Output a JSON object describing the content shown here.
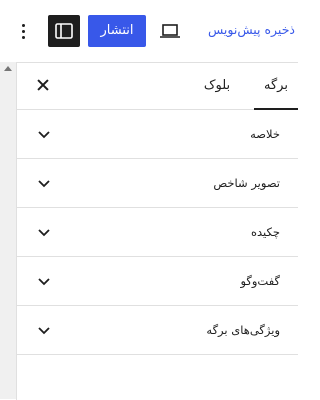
{
  "toolbar": {
    "more_icon": "more-vertical-icon",
    "settings_icon": "sidebar-settings-icon",
    "publish_label": "انتشار",
    "preview_icon": "laptop-preview-icon",
    "save_draft_label": "ذخیره پیش‌نویس",
    "accent_color": "#3858e9"
  },
  "sidebar": {
    "tabs": [
      {
        "label": "برگه",
        "active": true
      },
      {
        "label": "بلوک",
        "active": false
      }
    ],
    "close_icon": "close-icon",
    "sections": [
      {
        "label": "خلاصه"
      },
      {
        "label": "تصویر شاخص"
      },
      {
        "label": "چکیده"
      },
      {
        "label": "گفت‌وگو"
      },
      {
        "label": "ویژگی‌های برگه"
      }
    ]
  }
}
